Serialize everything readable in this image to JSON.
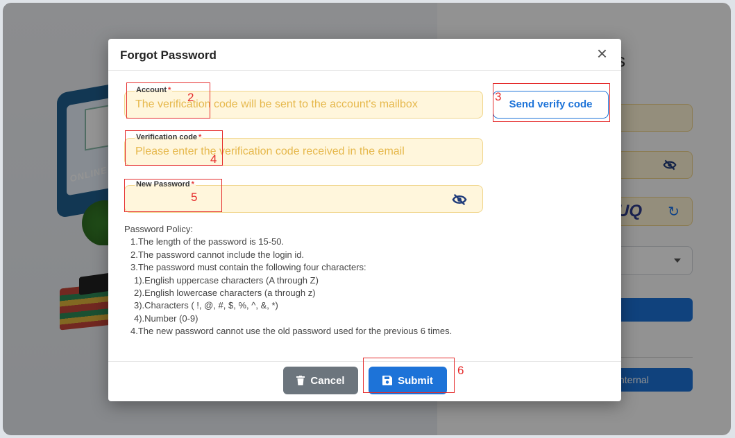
{
  "background": {
    "illustration_text": "ONLINE",
    "login_title_partial": "s",
    "captcha_partial": "UQ",
    "internal_button_partial": "nternal"
  },
  "modal": {
    "title": "Forgot Password",
    "close_glyph": "×",
    "account": {
      "label": "Account",
      "required": "*",
      "placeholder": "The verification code will be sent to the account's mailbox"
    },
    "send_button": "Send verify code",
    "verification": {
      "label": "Verification code",
      "required": "*",
      "placeholder": "Please enter the verification code received in the email"
    },
    "new_password": {
      "label": "New Password",
      "required": "*",
      "value": "",
      "toggle_icon": "eye-slash-icon"
    },
    "policy": {
      "title": "Password Policy:",
      "lines": [
        {
          "text": "1.The length of the password is 15-50.",
          "indent": 1
        },
        {
          "text": "2.The password cannot include the login id.",
          "indent": 1
        },
        {
          "text": "3.The password must contain the following four characters:",
          "indent": 1
        },
        {
          "text": "1).English uppercase characters (A through Z)",
          "indent": 2
        },
        {
          "text": "2).English lowercase characters (a through z)",
          "indent": 2
        },
        {
          "text": "3).Characters  ( !, @, #, $, %, ^, &, *)",
          "indent": 2
        },
        {
          "text": "4).Number  (0-9)",
          "indent": 2
        },
        {
          "text": "4.The new password cannot use the old password used for the previous 6 times.",
          "indent": 1
        }
      ]
    },
    "cancel_button": "Cancel",
    "submit_button": "Submit"
  },
  "annotations": [
    "2",
    "3",
    "4",
    "5",
    "6"
  ],
  "colors": {
    "primary": "#1d73d8",
    "field_bg": "#fff6dc",
    "placeholder": "#e6b84c",
    "cancel": "#6c757d",
    "annotation": "#e52b2b"
  }
}
